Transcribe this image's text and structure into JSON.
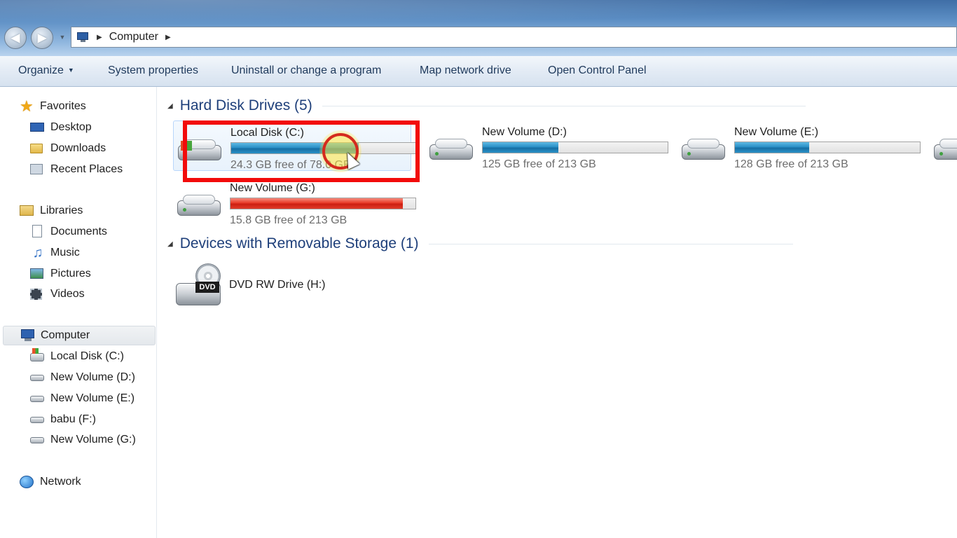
{
  "window": {
    "address": {
      "root_label": "Computer"
    }
  },
  "commandbar": {
    "organize": "Organize",
    "system_properties": "System properties",
    "uninstall": "Uninstall or change a program",
    "map_drive": "Map network drive",
    "control_panel": "Open Control Panel"
  },
  "sidebar": {
    "favorites": "Favorites",
    "desktop": "Desktop",
    "downloads": "Downloads",
    "recent": "Recent Places",
    "libraries": "Libraries",
    "documents": "Documents",
    "music": "Music",
    "pictures": "Pictures",
    "videos": "Videos",
    "computer": "Computer",
    "drive_c": "Local Disk (C:)",
    "drive_d": "New Volume (D:)",
    "drive_e": "New Volume (E:)",
    "drive_f": "babu (F:)",
    "drive_g": "New Volume (G:)",
    "network": "Network"
  },
  "main": {
    "hdd_group": "Hard Disk Drives (5)",
    "removable_group": "Devices with Removable Storage (1)",
    "drives": [
      {
        "name": "Local Disk (C:)",
        "free_text": "24.3 GB free of 78.0 GB",
        "used_fraction": 0.69,
        "bar_color": "#2a8fc6"
      },
      {
        "name": "New Volume (D:)",
        "free_text": "125 GB free of 213 GB",
        "used_fraction": 0.41,
        "bar_color": "#2a8fc6"
      },
      {
        "name": "New Volume (E:)",
        "free_text": "128 GB free of 213 GB",
        "used_fraction": 0.4,
        "bar_color": "#2a8fc6"
      },
      {
        "name": "New Volume (G:)",
        "free_text": "15.8 GB free of 213 GB",
        "used_fraction": 0.93,
        "bar_color": "#e73a28"
      }
    ],
    "dvd": {
      "name": "DVD RW Drive (H:)",
      "badge": "DVD"
    }
  },
  "annotation": {
    "highlight_color": "#f20b0b"
  },
  "icons": {
    "back": "back-arrow-icon",
    "forward": "forward-arrow-icon",
    "favorites": "star-icon",
    "computer": "computer-icon",
    "drive": "hard-drive-icon",
    "network": "network-icon"
  }
}
